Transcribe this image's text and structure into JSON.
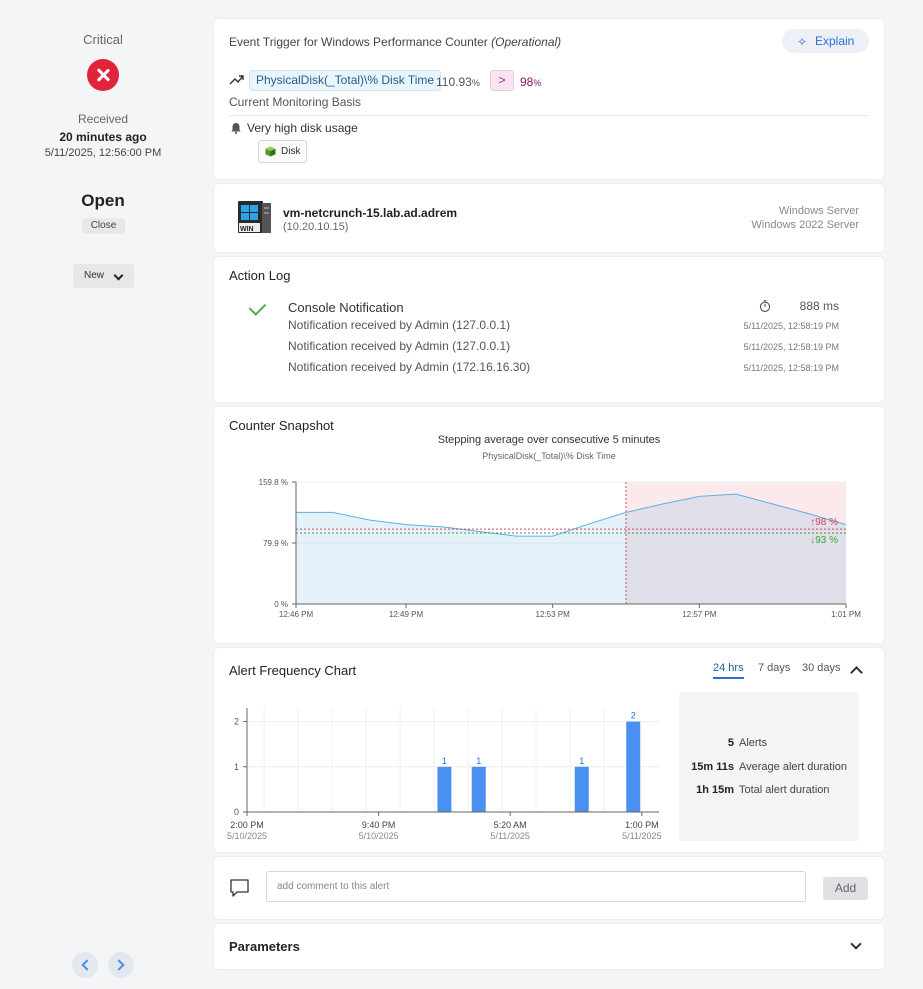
{
  "left_panel": {
    "severity": "Critical",
    "received_label": "Received",
    "received_ago": "20 minutes ago",
    "received_date": "5/11/2025, 12:56:00 PM",
    "state": "Open",
    "close_label": "Close",
    "status_select": "New"
  },
  "event": {
    "title": "Event Trigger for Windows Performance Counter",
    "title_suffix": "(Operational)",
    "explain_label": "Explain",
    "counter": "PhysicalDisk(_Total)\\% Disk Time",
    "current_value": "110.93",
    "current_unit": "%",
    "operator": ">",
    "threshold": "98",
    "threshold_unit": "%",
    "basis": "Current Monitoring Basis",
    "description": "Very high disk usage",
    "tag": "Disk"
  },
  "node": {
    "name": "vm-netcrunch-15.lab.ad.adrem",
    "ip": "(10.20.10.15)",
    "os_family": "Windows Server",
    "os_version": "Windows 2022 Server"
  },
  "action_log": {
    "title": "Action Log",
    "action": "Console Notification",
    "duration": "888 ms",
    "entries": [
      {
        "text": "Notification received by Admin (127.0.0.1)",
        "time": "5/11/2025, 12:58:19 PM"
      },
      {
        "text": "Notification received by Admin (127.0.0.1)",
        "time": "5/11/2025, 12:58:19 PM"
      },
      {
        "text": "Notification received by Admin (172.16.16.30)",
        "time": "5/11/2025, 12:58:19 PM"
      }
    ]
  },
  "snapshot": {
    "title": "Counter Snapshot",
    "chart_title": "Stepping average over consecutive 5 minutes",
    "chart_subtitle": "PhysicalDisk(_Total)\\% Disk Time"
  },
  "frequency": {
    "title": "Alert Frequency Chart",
    "ranges": [
      "24 hrs",
      "7 days",
      "30 days"
    ],
    "active_range": "24 hrs",
    "stats": [
      {
        "value": "5",
        "label": "Alerts"
      },
      {
        "value": "15m 11s",
        "label": "Average alert duration"
      },
      {
        "value": "1h 15m",
        "label": "Total alert duration"
      }
    ]
  },
  "comment": {
    "placeholder": "add comment to this alert",
    "add_label": "Add"
  },
  "parameters": {
    "title": "Parameters"
  },
  "colors": {
    "critical": "#e0253b",
    "accent": "#2a6fd6",
    "threshold_up": "#d0426a",
    "threshold_down": "#3aa33a",
    "bar": "#4a90f0",
    "line": "#5bb1e0"
  },
  "chart_data": [
    {
      "type": "area",
      "title": "Stepping average over consecutive 5 minutes",
      "subtitle": "PhysicalDisk(_Total)\\% Disk Time",
      "x_ticks": [
        "12:46 PM",
        "12:49 PM",
        "12:53 PM",
        "12:57 PM",
        "1:01 PM"
      ],
      "y_ticks": [
        "0 %",
        "79.9 %",
        "159.8 %"
      ],
      "ylim": [
        0,
        159.8
      ],
      "series": [
        {
          "x": [
            "12:46",
            "12:47",
            "12:48",
            "12:49",
            "12:50",
            "12:51",
            "12:52",
            "12:53",
            "12:54",
            "12:55",
            "12:56",
            "12:57",
            "12:58",
            "12:59",
            "13:00",
            "13:01"
          ],
          "values": [
            120,
            120,
            110,
            104,
            101,
            95,
            89,
            89,
            105,
            120,
            131,
            141,
            144,
            131,
            118,
            104
          ]
        }
      ],
      "thresholds": [
        {
          "label": "98 %",
          "direction": "up",
          "value": 98
        },
        {
          "label": "93 %",
          "direction": "down",
          "value": 93
        }
      ],
      "alert_start": "12:55"
    },
    {
      "type": "bar",
      "x_ticks": [
        {
          "time": "2:00 PM",
          "date": "5/10/2025"
        },
        {
          "time": "9:40 PM",
          "date": "5/10/2025"
        },
        {
          "time": "5:20 AM",
          "date": "5/11/2025"
        },
        {
          "time": "1:00 PM",
          "date": "5/11/2025"
        }
      ],
      "y_ticks": [
        "0",
        "1",
        "2"
      ],
      "ylim": [
        0,
        2.3
      ],
      "bars": [
        {
          "hours_from_start": 11.5,
          "value": 1,
          "label": "1"
        },
        {
          "hours_from_start": 13.5,
          "value": 1,
          "label": "1"
        },
        {
          "hours_from_start": 19.5,
          "value": 1,
          "label": "1"
        },
        {
          "hours_from_start": 22.5,
          "value": 2,
          "label": "2"
        }
      ]
    }
  ]
}
